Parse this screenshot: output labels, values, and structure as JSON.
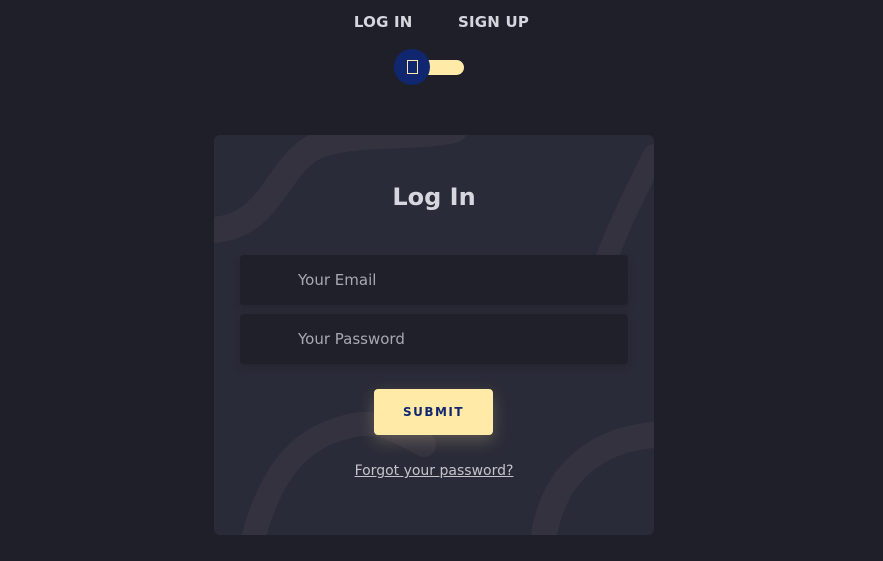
{
  "nav": {
    "login_tab": "LOG IN",
    "signup_tab": "SIGN UP"
  },
  "toggle": {
    "state": "log-in",
    "knob_icon": "toggle-knob-icon",
    "track_color": "#ffeba7",
    "knob_color": "#102770"
  },
  "form": {
    "title": "Log In",
    "email": {
      "placeholder": "Your Email",
      "value": "",
      "icon": "at-icon"
    },
    "password": {
      "placeholder": "Your Password",
      "value": "",
      "icon": "lock-icon"
    },
    "submit_label": "SUBMIT",
    "forgot_link": "Forgot your password?"
  },
  "colors": {
    "page_bg": "#1f1f29",
    "card_bg": "#2a2b38",
    "field_bg": "#1f2029",
    "accent": "#ffeba7",
    "accent_text": "#102770"
  }
}
